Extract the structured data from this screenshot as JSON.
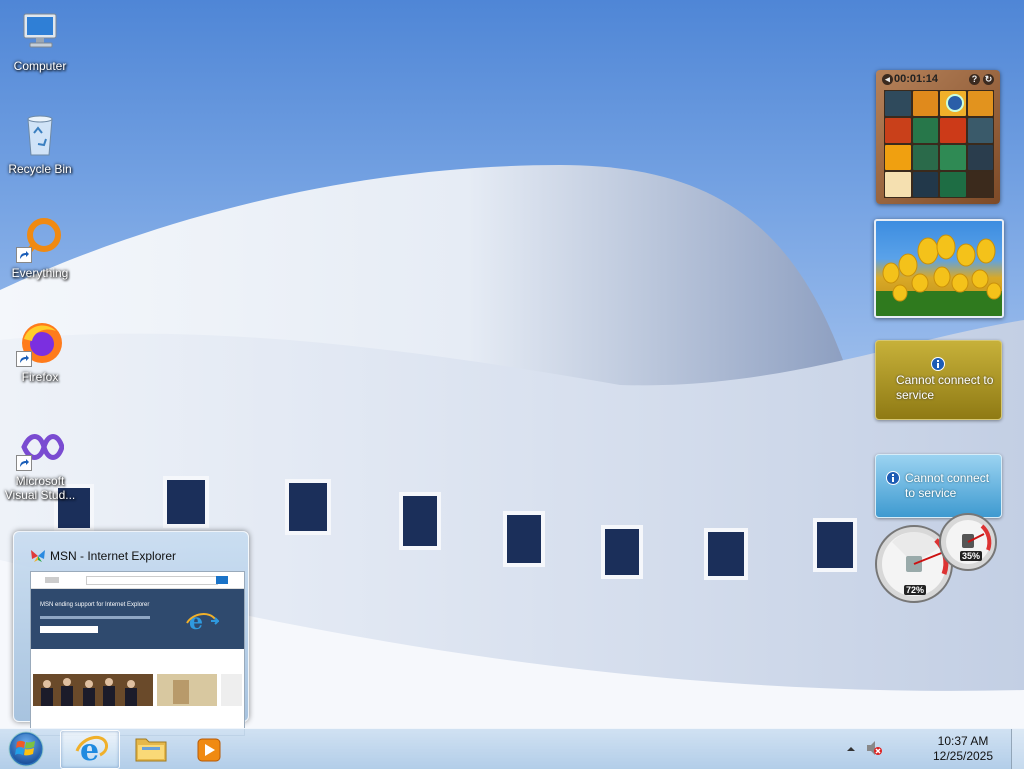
{
  "desktop": {
    "icons": [
      {
        "label": "Computer",
        "icon": "computer-icon"
      },
      {
        "label": "Recycle Bin",
        "icon": "recycle-bin-icon"
      },
      {
        "label": "Everything",
        "icon": "everything-search-icon"
      },
      {
        "label": "Firefox",
        "icon": "firefox-icon"
      },
      {
        "label": "Microsoft Visual Stud...",
        "icon": "visual-studio-icon"
      }
    ]
  },
  "gadgets": {
    "puzzle": {
      "timer": "00:01:14",
      "help": "?",
      "icon": "picture-puzzle-gadget"
    },
    "slideshow": {
      "icon": "slideshow-gadget"
    },
    "weather": {
      "message": "Cannot connect to service",
      "icon": "info-icon"
    },
    "feed": {
      "message": "Cannot connect to service",
      "icon": "info-icon"
    },
    "cpu_meter": {
      "cpu": "72%",
      "memory": "35%"
    }
  },
  "preview": {
    "title": "MSN - Internet Explorer",
    "page_heading": "MSN ending support for Internet Explorer"
  },
  "taskbar": {
    "pinned": [
      {
        "name": "Internet Explorer",
        "icon": "internet-explorer-icon",
        "active": true
      },
      {
        "name": "Windows Explorer",
        "icon": "folder-icon",
        "active": false
      },
      {
        "name": "Windows Media Player",
        "icon": "media-player-icon",
        "active": false
      }
    ],
    "clock": {
      "time": "10:37 AM",
      "date": "12/25/2025"
    }
  },
  "colors": {
    "taskbar": "#b9d3ec",
    "weather": "#b8a12c",
    "feed": "#5aaedc"
  }
}
